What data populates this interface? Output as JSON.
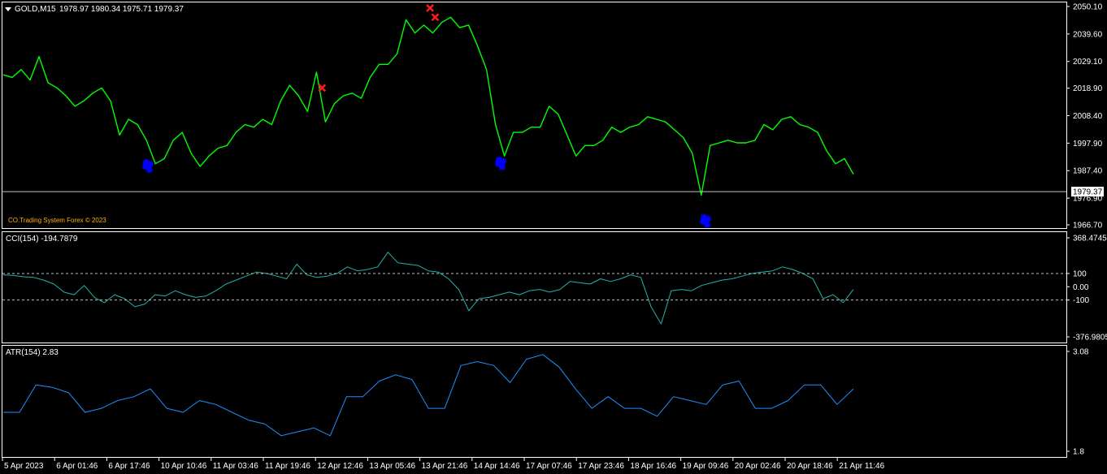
{
  "colors": {
    "background": "#000000",
    "frame": "#ffffff",
    "price": "#00ff00",
    "cci": "#20b2aa",
    "atr": "#1e90ff",
    "sell_marker": "#ff1a1a",
    "buy_marker": "#0000ff",
    "credit": "#ffb000"
  },
  "header": {
    "symbol_label": "GOLD,M15",
    "ohlc_label": "1978.97 1980.34 1975.71 1979.37",
    "menu_icon": "triangle-down-icon"
  },
  "credit": "CO.Trading System Forex © 2023",
  "current_price_label": "1979.37",
  "chart_data": [
    {
      "type": "line",
      "title": "GOLD,M15",
      "yticks": [
        "2050.10",
        "2039.60",
        "2029.10",
        "2018.90",
        "2008.40",
        "1997.90",
        "1987.40",
        "1976.90",
        "1966.70"
      ],
      "ylim": [
        1966.7,
        2050.1
      ],
      "current": 1979.37,
      "series": [
        {
          "values": [
            2024,
            2023,
            2026,
            2022,
            2031,
            2021,
            2019,
            2016,
            2012,
            2014,
            2017,
            2019,
            2014,
            2001,
            2007,
            2005,
            1999,
            1990,
            1992,
            1999,
            2002,
            1994,
            1989,
            1993,
            1996,
            1997,
            2002,
            2005,
            2004,
            2007,
            2005,
            2014,
            2020,
            2016,
            2010,
            2025,
            2006,
            2013,
            2016,
            2017,
            2015,
            2023,
            2028,
            2028,
            2032,
            2045,
            2040,
            2043,
            2040,
            2044,
            2046,
            2042,
            2043,
            2035,
            2026,
            2005,
            1993,
            2002,
            2002,
            2004,
            2004,
            2012,
            2009,
            2001,
            1993,
            1997,
            1997,
            1999,
            2004,
            2002,
            2004,
            2005,
            2008,
            2007,
            2006,
            2003,
            2000,
            1994,
            1978,
            1997,
            1998,
            1999,
            1998,
            1998,
            1999,
            2005,
            2003,
            2007,
            2008,
            2005,
            2004,
            2002,
            1995,
            1990,
            1992,
            1986
          ]
        }
      ],
      "sell_markers": [
        {
          "x": 0.375,
          "y": 2019
        },
        {
          "x": 0.502,
          "y": 2049.5
        },
        {
          "x": 0.508,
          "y": 2046
        }
      ],
      "buy_markers": [
        {
          "x": 0.17,
          "y": 1989
        },
        {
          "x": 0.585,
          "y": 1990
        },
        {
          "x": 0.826,
          "y": 1968
        }
      ]
    },
    {
      "type": "line",
      "title": "CCI(154) -194.7879",
      "yticks": [
        "368.4745",
        "100",
        "0.00",
        "-100",
        "-376.9805"
      ],
      "ylim": [
        -376.9805,
        368.4745
      ],
      "levels": [
        100,
        -100
      ],
      "series": [
        {
          "values": [
            90,
            85,
            75,
            70,
            50,
            20,
            -40,
            -60,
            10,
            -80,
            -120,
            -60,
            -90,
            -150,
            -130,
            -60,
            -70,
            -30,
            -60,
            -80,
            -70,
            -30,
            20,
            50,
            80,
            110,
            100,
            80,
            60,
            170,
            90,
            70,
            80,
            100,
            150,
            120,
            130,
            150,
            260,
            180,
            170,
            160,
            120,
            110,
            60,
            -20,
            -180,
            -90,
            -80,
            -60,
            -40,
            -60,
            -30,
            -20,
            -40,
            -20,
            40,
            30,
            20,
            60,
            40,
            60,
            90,
            70,
            -150,
            -280,
            -30,
            -20,
            -30,
            10,
            30,
            50,
            60,
            80,
            100,
            110,
            120,
            150,
            130,
            100,
            60,
            -90,
            -60,
            -120,
            -20
          ]
        }
      ]
    },
    {
      "type": "line",
      "title": "ATR(154) 2.83",
      "yticks": [
        "3.08",
        "1.8"
      ],
      "ylim": [
        1.8,
        3.08
      ],
      "series": [
        {
          "values": [
            2.3,
            2.3,
            2.65,
            2.62,
            2.55,
            2.3,
            2.35,
            2.45,
            2.5,
            2.6,
            2.35,
            2.3,
            2.45,
            2.4,
            2.3,
            2.2,
            2.15,
            2.0,
            2.05,
            2.1,
            2.0,
            2.5,
            2.5,
            2.7,
            2.78,
            2.72,
            2.35,
            2.35,
            2.9,
            2.95,
            2.9,
            2.68,
            2.98,
            3.04,
            2.88,
            2.6,
            2.35,
            2.5,
            2.35,
            2.35,
            2.25,
            2.5,
            2.45,
            2.4,
            2.65,
            2.7,
            2.35,
            2.35,
            2.45,
            2.65,
            2.65,
            2.4,
            2.6
          ]
        }
      ],
      "xticks": [
        "5 Apr 2023",
        "6 Apr 01:46",
        "6 Apr 17:46",
        "10 Apr 10:46",
        "11 Apr 03:46",
        "11 Apr 19:46",
        "12 Apr 12:46",
        "13 Apr 05:46",
        "13 Apr 21:46",
        "14 Apr 14:46",
        "17 Apr 07:46",
        "17 Apr 23:46",
        "18 Apr 16:46",
        "19 Apr 09:46",
        "20 Apr 02:46",
        "20 Apr 18:46",
        "21 Apr 11:46"
      ]
    }
  ]
}
